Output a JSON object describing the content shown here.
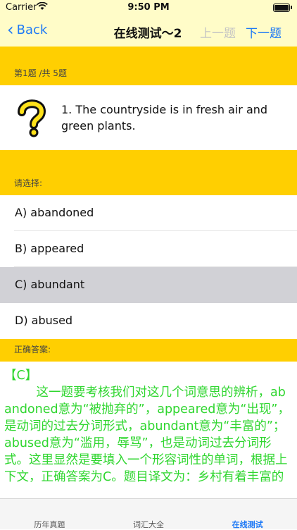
{
  "status_bar": {
    "carrier": "Carrier",
    "time": "9:50 PM"
  },
  "nav": {
    "back_label": "Back",
    "title": "在线测试～2",
    "prev_label": "上一题",
    "next_label": "下一题"
  },
  "question_progress": "第1题 /共 5题",
  "question": {
    "text": "1. The countryside is in fresh air and green plants."
  },
  "options_header": "请选择:",
  "options": [
    {
      "label": "A) abandoned",
      "selected": false
    },
    {
      "label": "B) appeared",
      "selected": false
    },
    {
      "label": "C) abundant",
      "selected": true
    },
    {
      "label": "D) abused",
      "selected": false
    }
  ],
  "answer_header": "正确答案:",
  "answer": {
    "label": "【C】",
    "text": "这一题要考核我们对这几个词意思的辨析，abandoned意为“被抛弃的”，appeared意为“出现”，是动词的过去分词形式，abundant意为“丰富的”；abused意为“滥用，辱骂”，也是动词过去分词形式。这里显然是要填入一个形容词性的单词，根据上下文，正确答案为C。题目译文为：乡村有着丰富的"
  },
  "tabs": [
    {
      "label": "历年真题",
      "active": false
    },
    {
      "label": "词汇大全",
      "active": false
    },
    {
      "label": "在线测试",
      "active": true
    }
  ],
  "colors": {
    "accent_yellow": "#ffcf01",
    "nav_bg": "#fffcc8",
    "link_blue": "#1f7af6",
    "answer_green": "#2fd62f",
    "selected_gray": "#d1d1d6"
  }
}
